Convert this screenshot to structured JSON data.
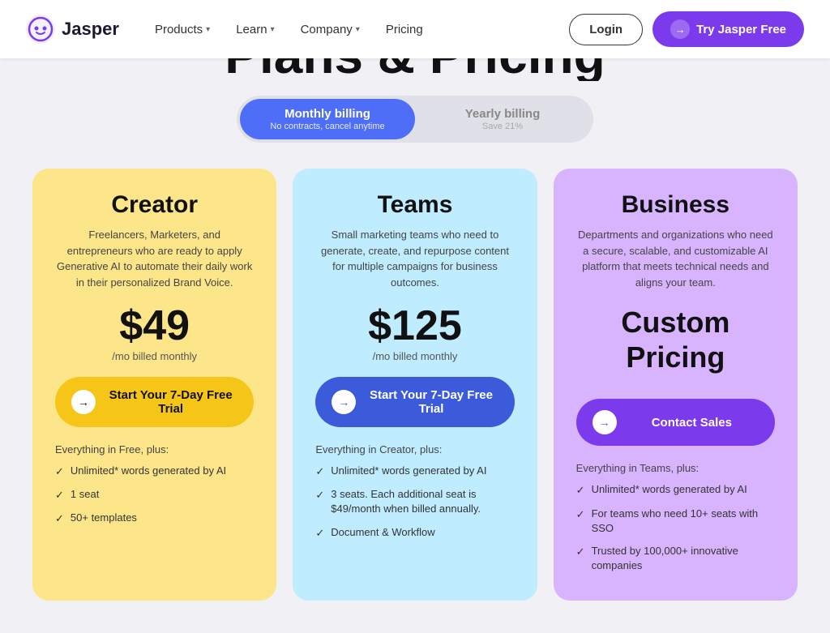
{
  "navbar": {
    "logo_text": "Jasper",
    "nav_items": [
      {
        "label": "Products",
        "has_chevron": true
      },
      {
        "label": "Learn",
        "has_chevron": true
      },
      {
        "label": "Company",
        "has_chevron": true
      },
      {
        "label": "Pricing",
        "has_chevron": false
      }
    ],
    "login_label": "Login",
    "try_label": "Try Jasper Free"
  },
  "page_title": "Plans & Pricing",
  "billing": {
    "monthly_label": "Monthly billing",
    "monthly_sub": "No contracts, cancel anytime",
    "yearly_label": "Yearly billing",
    "yearly_sub": "Save 21%"
  },
  "cards": [
    {
      "id": "creator",
      "title": "Creator",
      "desc": "Freelancers, Marketers, and entrepreneurs who are ready to apply Generative AI to automate their daily work in their personalized Brand Voice.",
      "price": "$49",
      "price_sub": "/mo billed monthly",
      "btn_label": "Start Your 7-Day Free Trial",
      "features_header": "Everything in Free, plus:",
      "features": [
        "Unlimited* words generated by AI",
        "1 seat",
        "50+ templates"
      ]
    },
    {
      "id": "teams",
      "title": "Teams",
      "desc": "Small marketing teams who need to generate, create, and repurpose content for multiple campaigns for business outcomes.",
      "price": "$125",
      "price_sub": "/mo billed monthly",
      "btn_label": "Start Your 7-Day Free Trial",
      "features_header": "Everything in Creator, plus:",
      "features": [
        "Unlimited* words generated by AI",
        "3 seats. Each additional seat is $49/month when billed annually.",
        "Document & Workflow"
      ]
    },
    {
      "id": "business",
      "title": "Business",
      "desc": "Departments and organizations who need a secure, scalable, and customizable AI platform that meets technical needs and aligns your team.",
      "price": "Custom Pricing",
      "price_sub": "",
      "btn_label": "Contact Sales",
      "features_header": "Everything in Teams, plus:",
      "features": [
        "Unlimited* words generated by AI",
        "For teams who need 10+ seats with SSO",
        "Trusted by 100,000+ innovative companies"
      ]
    }
  ]
}
